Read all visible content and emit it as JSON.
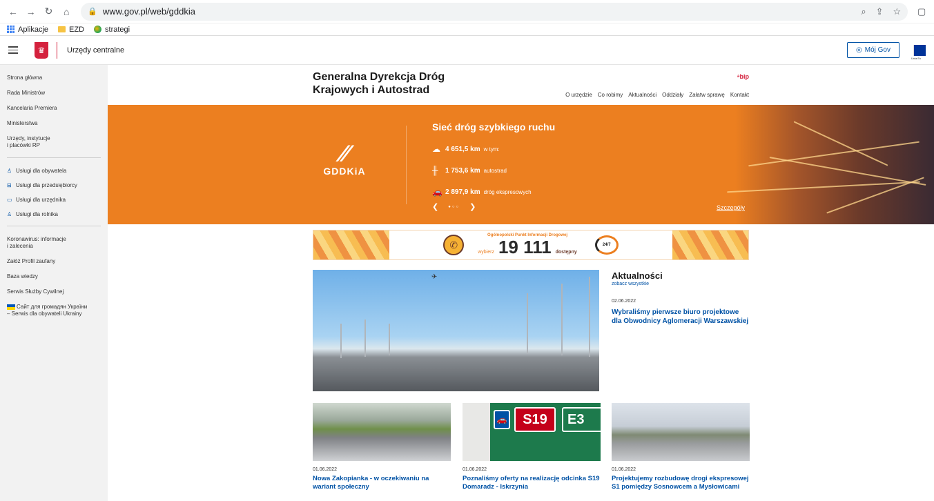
{
  "browser": {
    "url": "www.gov.pl/web/gddkia",
    "bookmarks": [
      "Aplikacje",
      "EZD",
      "strategi"
    ]
  },
  "gov_header": {
    "title": "Urzędy centralne",
    "moj_gov": "Mój Gov",
    "eu_label": "Unia Eu"
  },
  "sidebar": {
    "nav": [
      "Strona główna",
      "Rada Ministrów",
      "Kancelaria Premiera",
      "Ministerstwa",
      "Urzędy, instytucje",
      "i placówki RP"
    ],
    "services": [
      "Usługi dla obywatela",
      "Usługi dla przedsiębiorcy",
      "Usługi dla urzędnika",
      "Usługi dla rolnika"
    ],
    "links": [
      "Koronawirus: informacje",
      "i zalecenia",
      "Załóż Profil zaufany",
      "Baza wiedzy",
      "Serwis Służby Cywilnej"
    ],
    "ukraine_1": "Сайт для громадян України",
    "ukraine_2": "– Serwis dla obywateli Ukrainy"
  },
  "org": {
    "name_line1": "Generalna Dyrekcja Dróg",
    "name_line2": "Krajowych i Autostrad",
    "bip": "bip",
    "nav": [
      "O urzędzie",
      "Co robimy",
      "Aktualności",
      "Oddziały",
      "Załatw sprawę",
      "Kontakt"
    ]
  },
  "banner": {
    "logo_text": "GDDKiA",
    "title": "Sieć dróg szybkiego ruchu",
    "stats": [
      {
        "value": "4 651,5 km",
        "label": "w tym:"
      },
      {
        "value": "1 753,6 km",
        "label": "autostrad"
      },
      {
        "value": "2 897,9 km",
        "label": "dróg ekspresowych"
      }
    ],
    "details": "Szczegóły"
  },
  "ad": {
    "top": "Ogólnopolski Punkt Informacji Drogowej",
    "left": "wybierz",
    "number": "19 111",
    "right": "dostępny",
    "badge": "24/7"
  },
  "news": {
    "heading": "Aktualności",
    "see_all": "zobacz wszystkie",
    "featured_date": "02.06.2022",
    "featured_title": "Wybraliśmy pierwsze biuro projektowe dla Obwodnicy Aglomeracji Warszawskiej",
    "tiles": [
      {
        "date": "01.06.2022",
        "title": "Nowa Zakopianka - w oczekiwaniu na wariant społeczny"
      },
      {
        "date": "01.06.2022",
        "title": "Poznaliśmy oferty na realizację odcinka S19 Domaradz - Iskrzynia"
      },
      {
        "date": "01.06.2022",
        "title": "Projektujemy rozbudowę drogi ekspresowej S1 pomiędzy Sosnowcem a Mysłowicami"
      }
    ],
    "sign_s19": "S19",
    "sign_e": "E3"
  }
}
